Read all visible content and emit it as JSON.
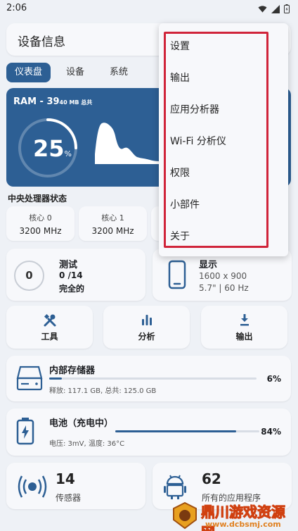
{
  "status_bar": {
    "time": "2:06"
  },
  "header": {
    "title": "设备信息"
  },
  "tabs": [
    {
      "label": "仪表盘",
      "active": true
    },
    {
      "label": "设备",
      "active": false
    },
    {
      "label": "系统",
      "active": false
    }
  ],
  "ram": {
    "label_prefix": "RAM - 39",
    "label_suffix": "40 MB 总共",
    "percent": "25",
    "percent_sign": "%",
    "usage_fraction": 0.25
  },
  "cpu": {
    "title": "中央处理器状态",
    "cores": [
      {
        "name": "核心 0",
        "freq": "3200 MHz"
      },
      {
        "name": "核心 1",
        "freq": "3200 MHz"
      }
    ]
  },
  "test": {
    "count": "0",
    "label": "测试",
    "progress": "0 /14",
    "status": "完全的"
  },
  "display": {
    "label": "显示",
    "resolution": "1600 x 900",
    "details": "5.7\" | 60 Hz"
  },
  "actions": [
    {
      "label": "工具",
      "icon": "tools-icon"
    },
    {
      "label": "分析",
      "icon": "bar-chart-icon"
    },
    {
      "label": "输出",
      "icon": "download-icon"
    }
  ],
  "storage": {
    "title": "内部存储器",
    "percent": "6%",
    "fraction": 0.06,
    "detail": "释放: 117.1 GB, 总共: 125.0 GB"
  },
  "battery": {
    "title": "电池（充电中）",
    "percent": "84%",
    "fraction": 0.84,
    "detail": "电压: 3mV, 温度: 36°C"
  },
  "sensors": {
    "count": "14",
    "label": "传感器"
  },
  "apps": {
    "count": "62",
    "label": "所有的应用程序"
  },
  "menu": {
    "items": [
      "设置",
      "输出",
      "应用分析器",
      "Wi-Fi 分析仪",
      "权限",
      "小部件",
      "关于"
    ]
  },
  "watermark": {
    "title": "鼎川游戏资源网",
    "url": "www.dcbsmj.com"
  },
  "colors": {
    "accent": "#2d5f94",
    "background": "#eef1f6",
    "highlight_border": "#d0243a"
  }
}
